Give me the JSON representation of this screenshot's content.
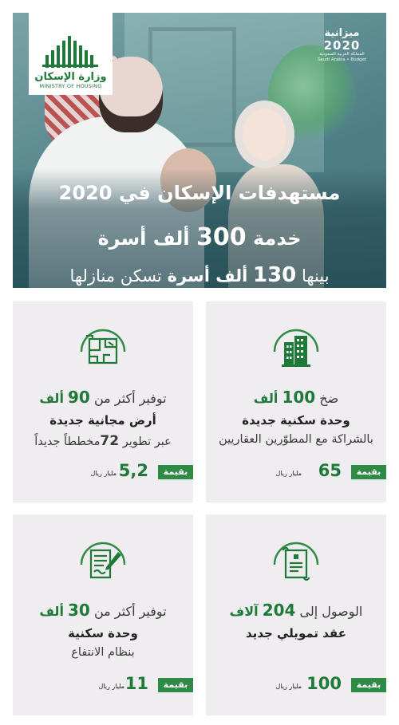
{
  "colors": {
    "brand_green": "#1f7a3a",
    "badge_green": "#2f8a45",
    "card_bg": "#efedef"
  },
  "logo": {
    "ar": "وزارة الإسكان",
    "en": "MINISTRY OF HOUSING"
  },
  "budget": {
    "ar": "ميزانية",
    "year": "2020",
    "sub": "المملكة العربية السعودية",
    "en": "Saudi Arabia • Budget"
  },
  "hero": {
    "line1": "مستهدفات الإسكان في 2020",
    "line2_word": "خدمة",
    "line2_num": "300",
    "line2_rest": "ألف أسرة",
    "line3_pre": "بينها",
    "line3_num": "130",
    "line3_bold": "ألف أسرة",
    "line3_rest": "تسكن منازلها"
  },
  "cards": [
    {
      "icon": "buildings-icon",
      "l1_pre": "ضخ",
      "l1_num": "100",
      "l1_post": "ألف",
      "l2": "وحدة سكنية جديدة",
      "l3": "بالشراكة مع المطوّرين العقاريين",
      "badge": "بقيمة",
      "amount": "65",
      "unit": "مليار ريال"
    },
    {
      "icon": "land-plan-icon",
      "l1_pre": "توفير أكثر من",
      "l1_num": "90",
      "l1_post": "ألف",
      "l2": "أرض مجانية جديدة",
      "l3_pre": "عبر تطوير",
      "l3_num": "72",
      "l3_post": "مخططاً جديداً",
      "badge": "بقيمة",
      "amount": "5,2",
      "unit": "مليار ريال"
    },
    {
      "icon": "contract-icon",
      "l1_pre": "الوصول إلى",
      "l1_num": "204",
      "l1_post": "آلاف",
      "l2": "عقد تمويلي جديد",
      "badge": "بقيمة",
      "amount": "100",
      "unit": "مليار ريال"
    },
    {
      "icon": "document-sign-icon",
      "l1_pre": "توفير أكثر من",
      "l1_num": "30",
      "l1_post": "ألف",
      "l2": "وحدة سكنية",
      "l3": "بنظام الانتفاع",
      "badge": "بقيمة",
      "amount": "11",
      "unit": "مليار ريال"
    }
  ]
}
